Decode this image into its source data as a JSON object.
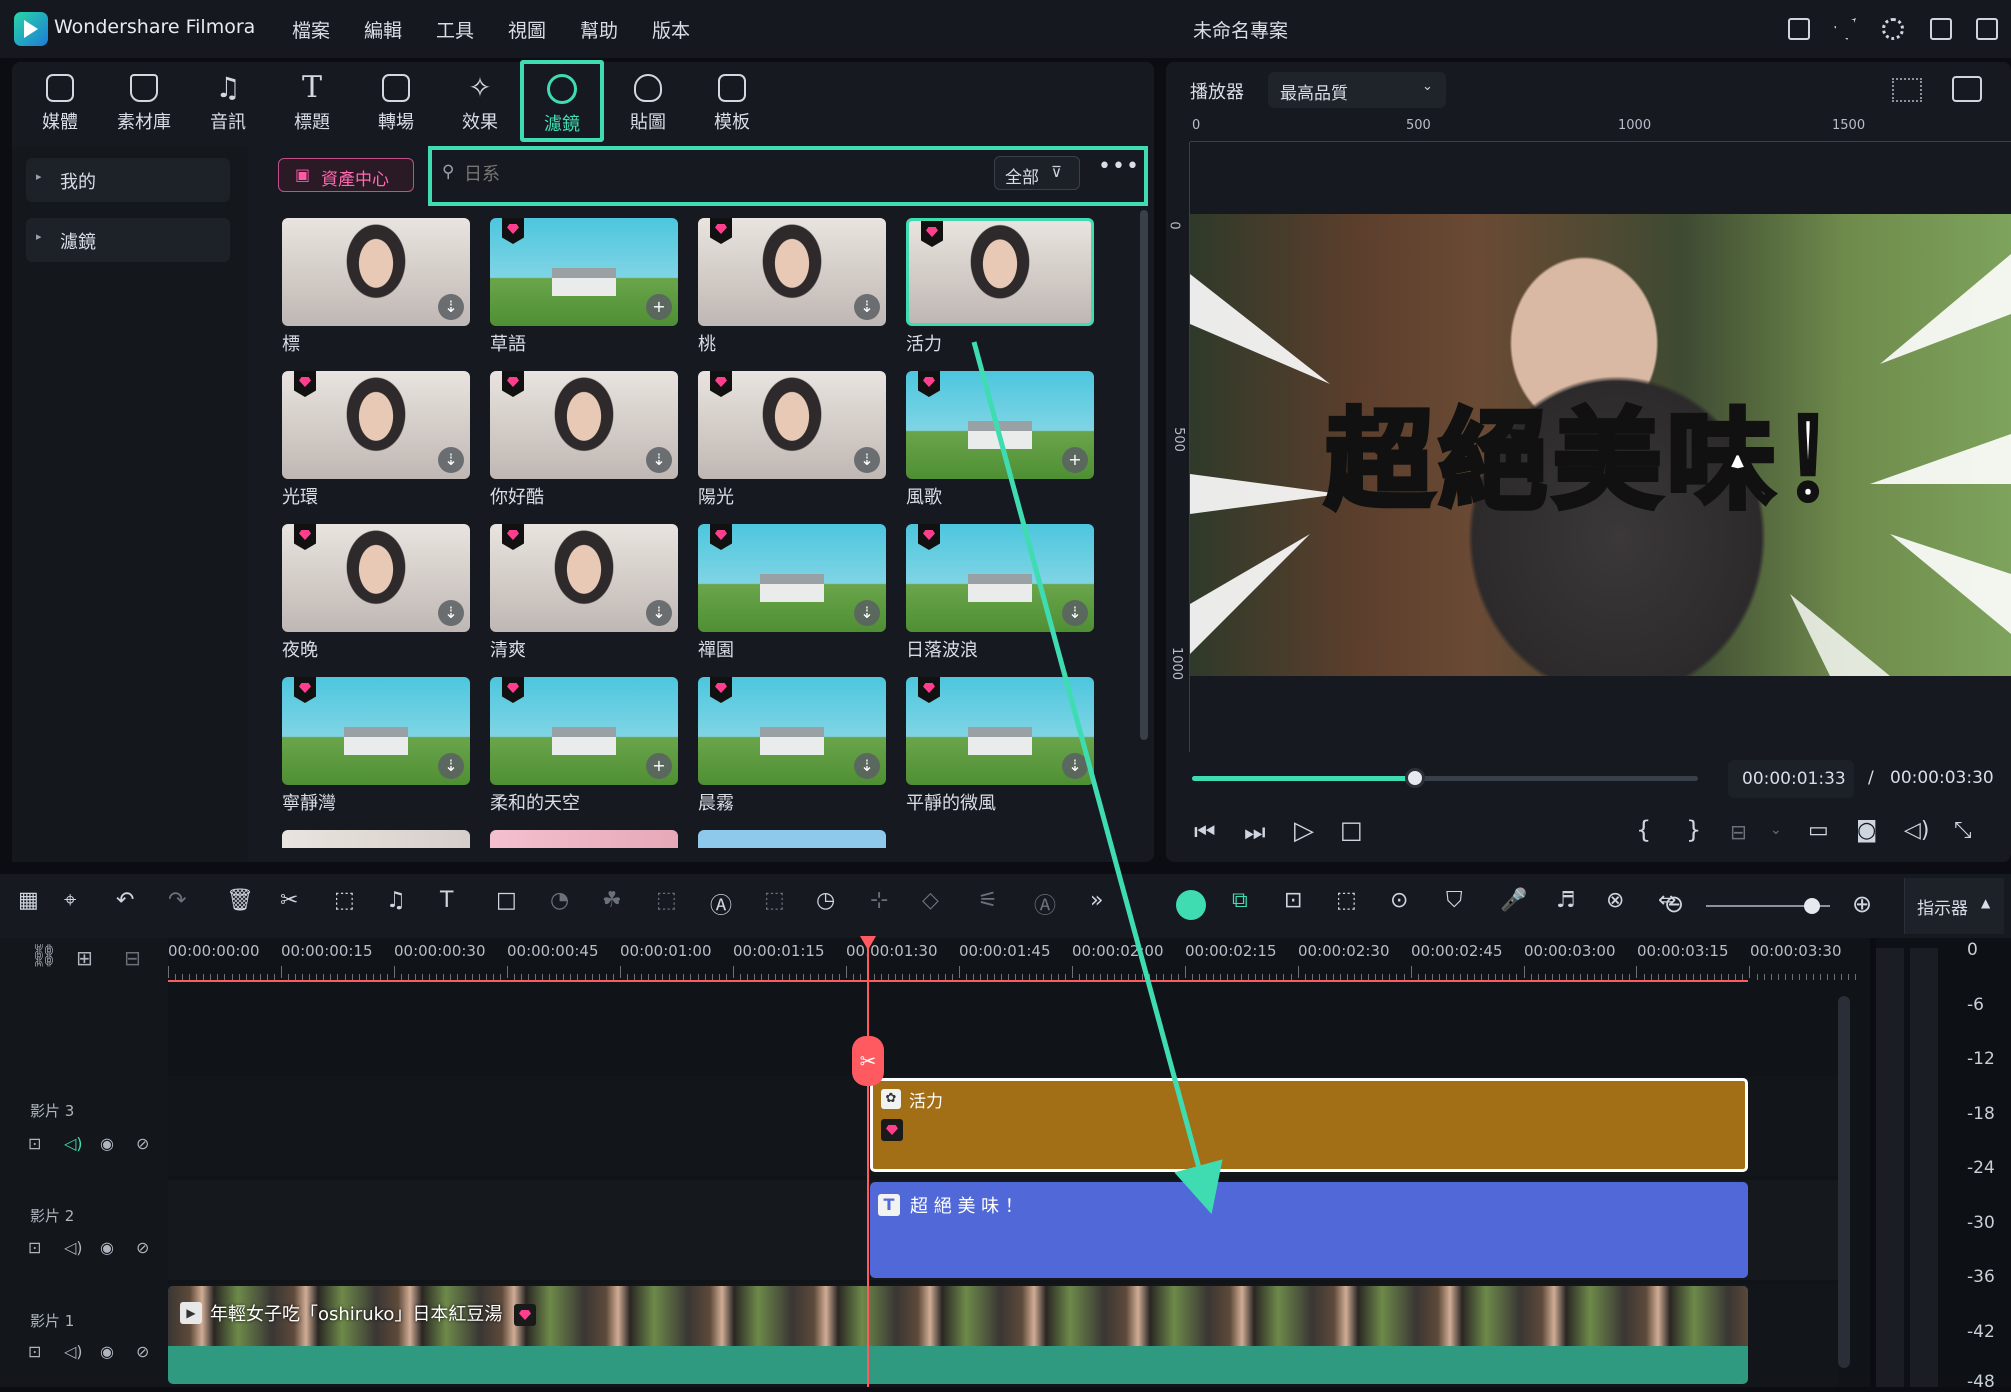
{
  "menubar": {
    "app_name": "Wondershare Filmora",
    "menus": [
      "檔案",
      "編輯",
      "工具",
      "視圖",
      "幫助",
      "版本"
    ],
    "project_title": "未命名專案"
  },
  "media_tabs": [
    {
      "label": "媒體",
      "icon": "media-icon"
    },
    {
      "label": "素材庫",
      "icon": "store-icon"
    },
    {
      "label": "音訊",
      "icon": "music-note-icon"
    },
    {
      "label": "標題",
      "icon": "text-t-icon"
    },
    {
      "label": "轉場",
      "icon": "transition-icon"
    },
    {
      "label": "效果",
      "icon": "sparkle-icon"
    },
    {
      "label": "濾鏡",
      "icon": "filter-icon",
      "active": true
    },
    {
      "label": "貼圖",
      "icon": "sticker-icon"
    },
    {
      "label": "模板",
      "icon": "template-icon"
    }
  ],
  "sidebar": {
    "items": [
      "我的",
      "濾鏡"
    ]
  },
  "asset_center_label": "資產中心",
  "search": {
    "placeholder": "日系",
    "filter_label": "全部"
  },
  "filters": [
    {
      "name": "標",
      "kind": "portrait",
      "premium": false,
      "action": "download"
    },
    {
      "name": "草語",
      "kind": "landscape",
      "premium": true,
      "action": "add"
    },
    {
      "name": "桃",
      "kind": "portrait",
      "premium": true,
      "action": "download"
    },
    {
      "name": "活力",
      "kind": "portrait",
      "premium": true,
      "action": "none",
      "selected": true
    },
    {
      "name": "光環",
      "kind": "portrait",
      "premium": true,
      "action": "download"
    },
    {
      "name": "你好酷",
      "kind": "portrait",
      "premium": true,
      "action": "download"
    },
    {
      "name": "陽光",
      "kind": "portrait",
      "premium": true,
      "action": "download"
    },
    {
      "name": "風歌",
      "kind": "landscape",
      "premium": true,
      "action": "add"
    },
    {
      "name": "夜晚",
      "kind": "portrait",
      "premium": true,
      "action": "download"
    },
    {
      "name": "清爽",
      "kind": "portrait",
      "premium": true,
      "action": "download"
    },
    {
      "name": "禪園",
      "kind": "landscape",
      "premium": true,
      "action": "download"
    },
    {
      "name": "日落波浪",
      "kind": "landscape",
      "premium": true,
      "action": "download"
    },
    {
      "name": "寧靜灣",
      "kind": "landscape",
      "premium": true,
      "action": "download"
    },
    {
      "name": "柔和的天空",
      "kind": "landscape",
      "premium": true,
      "action": "add"
    },
    {
      "name": "晨霧",
      "kind": "landscape",
      "premium": true,
      "action": "download"
    },
    {
      "name": "平靜的微風",
      "kind": "landscape",
      "premium": true,
      "action": "download"
    }
  ],
  "player": {
    "label": "播放器",
    "quality": "最高品質",
    "ruler_h": [
      "0",
      "500",
      "1000",
      "1500"
    ],
    "ruler_v": [
      "0",
      "500",
      "1000"
    ],
    "caption": "超絕美味！",
    "current_time": "00:00:01:33",
    "separator": "/",
    "total_time": "00:00:03:30",
    "progress": 0.44
  },
  "timeline": {
    "indicator_label": "指示器",
    "ruler": [
      "00:00:00:00",
      "00:00:00:15",
      "00:00:00:30",
      "00:00:00:45",
      "00:00:01:00",
      "00:00:01:15",
      "00:00:01:30",
      "00:00:01:45",
      "00:00:02:00",
      "00:00:02:15",
      "00:00:02:30",
      "00:00:02:45",
      "00:00:03:00",
      "00:00:03:15",
      "00:00:03:30"
    ],
    "tracks": [
      {
        "label": "影片 3"
      },
      {
        "label": "影片 2"
      },
      {
        "label": "影片 1"
      }
    ],
    "clips": {
      "filter": "活力",
      "title": "超 絕 美 味 ！",
      "video": "年輕女子吃「oshiruko」日本紅豆湯"
    },
    "db_scale": [
      "0",
      "-6",
      "-12",
      "-18",
      "-24",
      "-30",
      "-36",
      "-42",
      "-48"
    ]
  },
  "colors": {
    "accent": "#3fdcb2",
    "filter_clip": "#a26f17",
    "title_clip": "#5169d8",
    "video_clip": "#2f9a80",
    "playhead": "#ff5a5f",
    "premium_gem": "#ff3f8e"
  }
}
